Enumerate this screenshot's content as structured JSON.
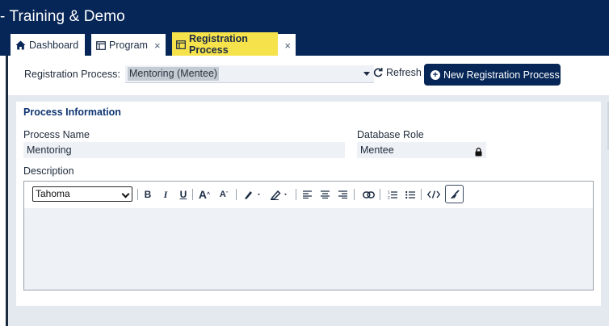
{
  "app": {
    "title": "- Training & Demo"
  },
  "tabs": [
    {
      "label": "Dashboard",
      "icon": "home-icon"
    },
    {
      "label": "Program",
      "icon": "window-icon",
      "close": "×"
    },
    {
      "label": "Registration Process",
      "icon": "window-icon",
      "close": "×",
      "active": true
    }
  ],
  "toolbar": {
    "registration_label": "Registration Process:",
    "registration_value": "Mentoring (Mentee)",
    "refresh_label": "Refresh",
    "new_button_label": "New Registration Process"
  },
  "form": {
    "section_title": "Process Information",
    "process_name_label": "Process Name",
    "process_name_value": "Mentoring",
    "database_role_label": "Database Role",
    "database_role_value": "Mentee",
    "description_label": "Description",
    "editor_font": "Tahoma"
  },
  "colors": {
    "header": "#062657",
    "active_tab": "#f6e24b",
    "accent_text": "#0d3471"
  }
}
